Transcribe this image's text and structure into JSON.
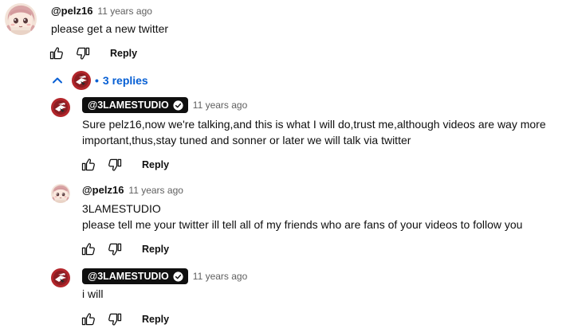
{
  "comment": {
    "handle": "@pelz16",
    "time": "11 years ago",
    "text": "please get a new twitter",
    "reply_label": "Reply"
  },
  "replies_toggle": {
    "label": "3 replies",
    "separator": "•",
    "icon": "chevron-up-icon",
    "accent": "#065fd4"
  },
  "replies": [
    {
      "handle": "@3LAMESTUDIO",
      "verified": true,
      "time": "11 years ago",
      "lines": [
        "Sure pelz16,now we're talking,and this is what I will do,trust me,although  videos are way more",
        "important,thus,stay tuned and sonner or later we will talk via twitter"
      ],
      "reply_label": "Reply"
    },
    {
      "handle": "@pelz16",
      "verified": false,
      "time": "11 years ago",
      "lines": [
        "3LAMESTUDIO",
        "please tell me your twitter ill tell all of my friends who are fans of your videos to follow you"
      ],
      "reply_label": "Reply"
    },
    {
      "handle": "@3LAMESTUDIO",
      "verified": true,
      "time": "11 years ago",
      "lines": [
        "i will"
      ],
      "reply_label": "Reply"
    }
  ],
  "icons": {
    "like": "thumbs-up-icon",
    "dislike": "thumbs-down-icon",
    "verified": "verified-check-icon"
  },
  "colors": {
    "owner_chip": "#0f0f0f",
    "secondary_text": "#606060"
  }
}
